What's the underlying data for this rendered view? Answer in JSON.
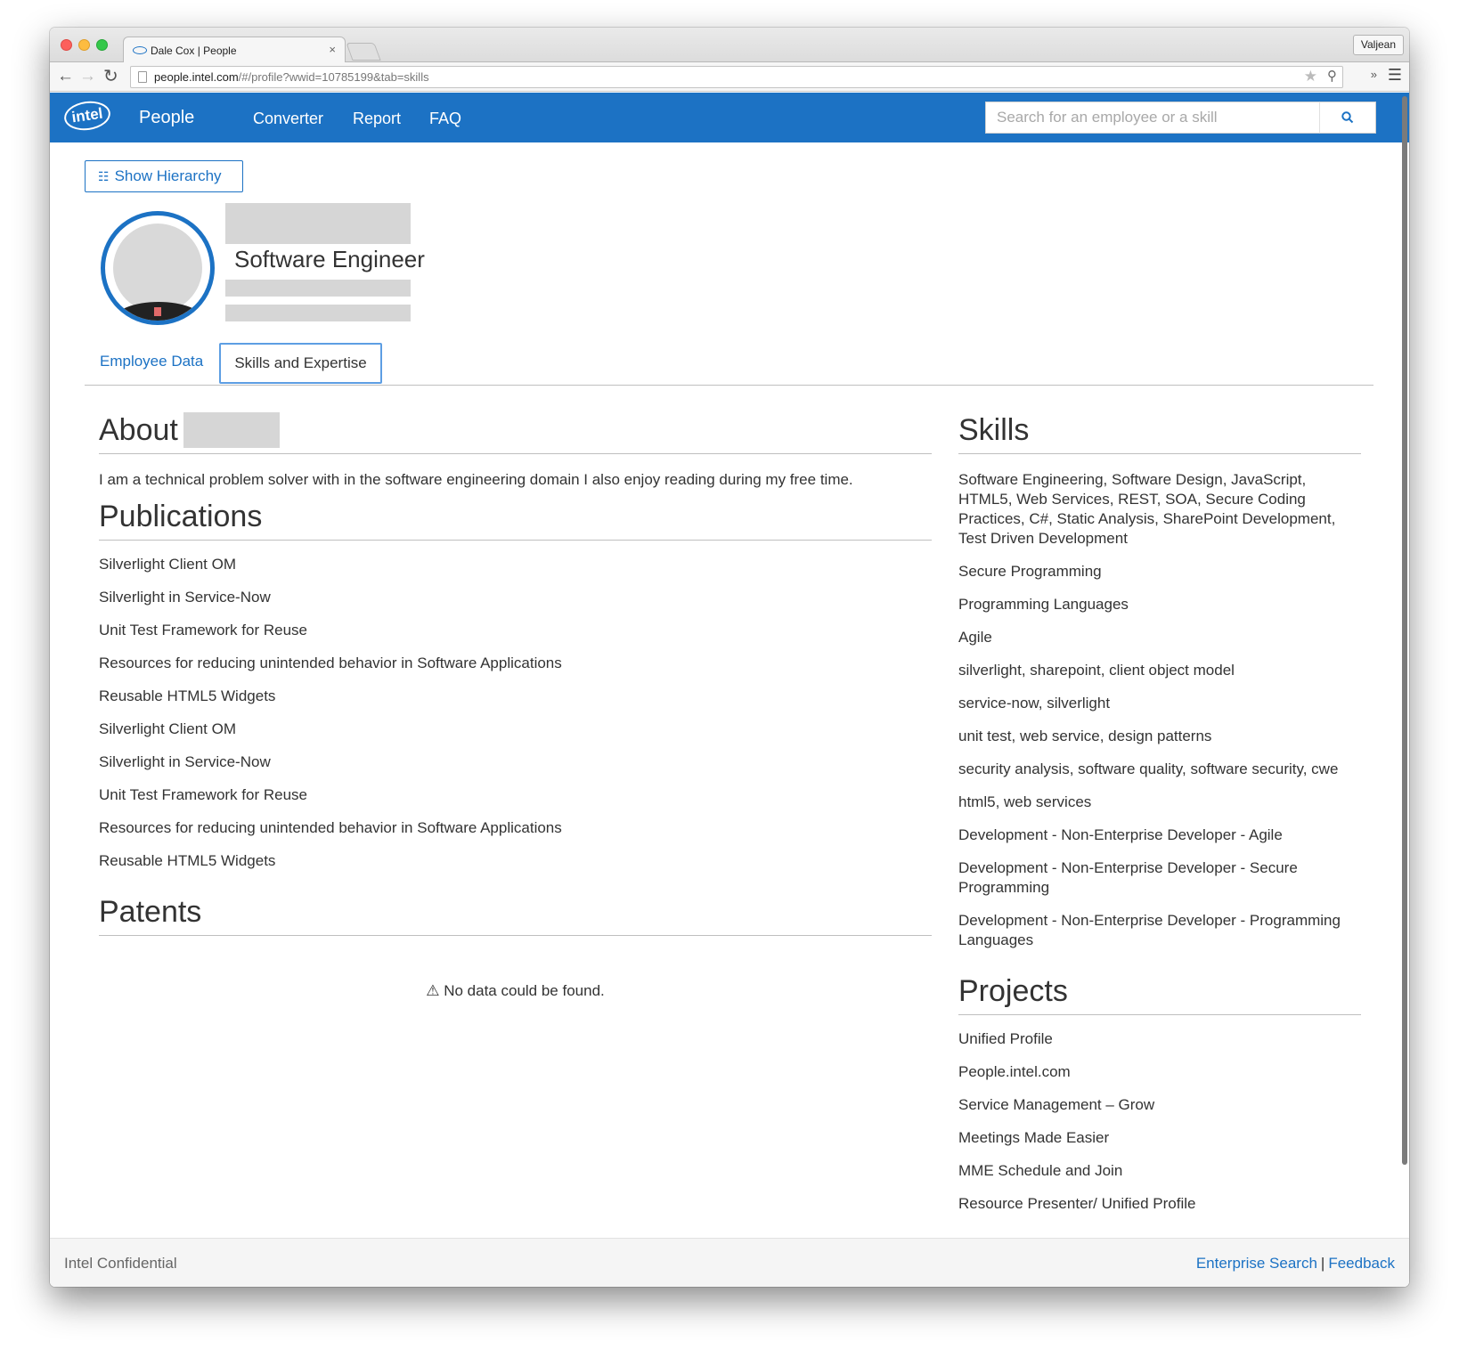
{
  "browser": {
    "tab_title": "Dale Cox | People",
    "tab_close": "×",
    "user_name": "Valjean",
    "url_host": "people.intel.com",
    "url_path": "/#/profile?wwid=10785199&tab=skills"
  },
  "navbar": {
    "logo_text": "intel",
    "brand": "People",
    "links": [
      "Converter",
      "Report",
      "FAQ"
    ],
    "search_placeholder": "Search for an employee or a skill"
  },
  "profile": {
    "hierarchy_button": "Show Hierarchy",
    "job_title": "Software Engineer",
    "tabs": [
      "Employee Data",
      "Skills and Expertise"
    ],
    "active_tab": "Skills and Expertise"
  },
  "about": {
    "heading": "About",
    "text": "I am a technical problem solver with in the software engineering domain I also enjoy reading during my free time."
  },
  "publications": {
    "heading": "Publications",
    "items": [
      "Silverlight Client OM",
      "Silverlight in Service-Now",
      "Unit Test Framework for Reuse",
      "Resources for reducing unintended behavior in Software Applications",
      "Reusable HTML5 Widgets",
      "Silverlight Client OM",
      "Silverlight in Service-Now",
      "Unit Test Framework for Reuse",
      "Resources for reducing unintended behavior in Software Applications",
      "Reusable HTML5 Widgets"
    ]
  },
  "patents": {
    "heading": "Patents",
    "empty_message": "No data could be found."
  },
  "skills": {
    "heading": "Skills",
    "items": [
      "Software Engineering, Software Design, JavaScript, HTML5, Web Services, REST, SOA, Secure Coding Practices, C#, Static Analysis, SharePoint Development, Test Driven Development",
      "Secure Programming",
      "Programming Languages",
      "Agile",
      "silverlight, sharepoint, client object model",
      "service-now, silverlight",
      "unit test, web service, design patterns",
      "security analysis, software quality, software security, cwe",
      "html5, web services",
      "Development - Non-Enterprise Developer - Agile",
      "Development - Non-Enterprise Developer - Secure Programming",
      "Development - Non-Enterprise Developer - Programming Languages"
    ]
  },
  "projects": {
    "heading": "Projects",
    "items": [
      "Unified Profile",
      "People.intel.com",
      "Service Management – Grow",
      "Meetings Made Easier",
      "MME Schedule and Join",
      "Resource Presenter/ Unified Profile"
    ]
  },
  "footer": {
    "left": "Intel Confidential",
    "links": [
      "Enterprise Search",
      "Feedback"
    ],
    "separator": "|"
  },
  "colors": {
    "brand_blue": "#1c72c4",
    "tab_focus": "#5d9ee3"
  }
}
